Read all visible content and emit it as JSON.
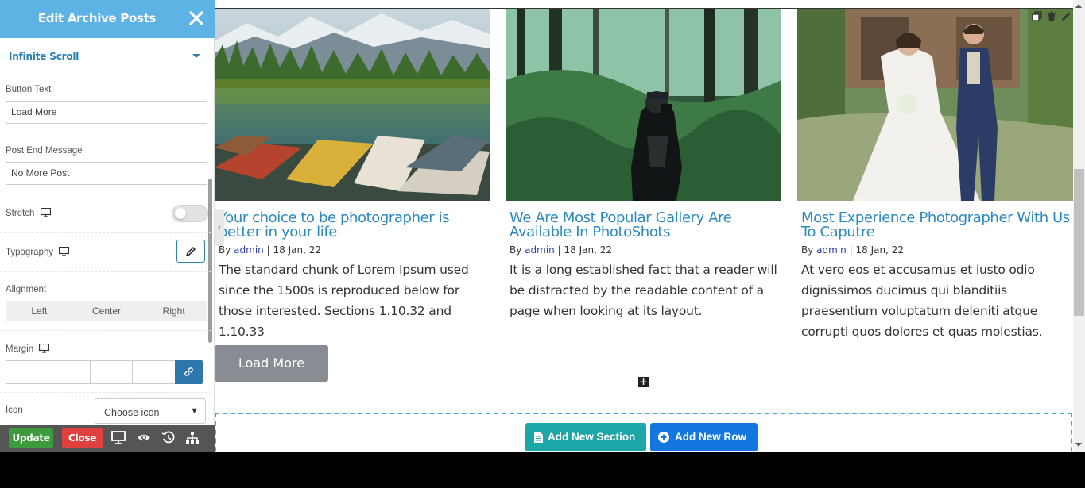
{
  "sidebar": {
    "title": "Edit Archive Posts",
    "section": "Infinite Scroll",
    "fields": {
      "button_text_label": "Button Text",
      "button_text_value": "Load More",
      "post_end_label": "Post End Message",
      "post_end_value": "No More Post",
      "stretch_label": "Stretch",
      "stretch_on": false,
      "typography_label": "Typography",
      "alignment_label": "Alignment",
      "alignment_options": [
        "Left",
        "Center",
        "Right"
      ],
      "margin_label": "Margin",
      "icon_label": "Icon",
      "icon_select": "Choose icon"
    },
    "footer": {
      "update": "Update",
      "close": "Close"
    },
    "colors": {
      "header": "#5db3e4",
      "accent": "#2a7fb5",
      "update": "#3c9b3c",
      "close": "#e0413f"
    }
  },
  "posts": [
    {
      "title": "Your choice to be photographer is better in your life",
      "by": "By",
      "author": "admin",
      "date": "18 Jan, 22",
      "excerpt": "The standard chunk of Lorem Ipsum used since the 1500s is reproduced below for those interested. Sections 1.10.32 and 1.10.33"
    },
    {
      "title": "We Are Most Popular Gallery Are Available In PhotoShots",
      "by": "By",
      "author": "admin",
      "date": "18 Jan, 22",
      "excerpt": "It is a long established fact that a reader will be distracted by the readable content of a page when looking at its layout."
    },
    {
      "title": "Most Experience Photographer With Us To Caputre",
      "by": "By",
      "author": "admin",
      "date": "18 Jan, 22",
      "excerpt": "At vero eos et accusamus et iusto odio dignissimos ducimus qui blanditiis praesentium voluptatum deleniti atque corrupti quos dolores et quas molestias."
    }
  ],
  "canvas": {
    "load_more": "Load More",
    "add_section": "Add New Section",
    "add_row": "Add New Row"
  }
}
